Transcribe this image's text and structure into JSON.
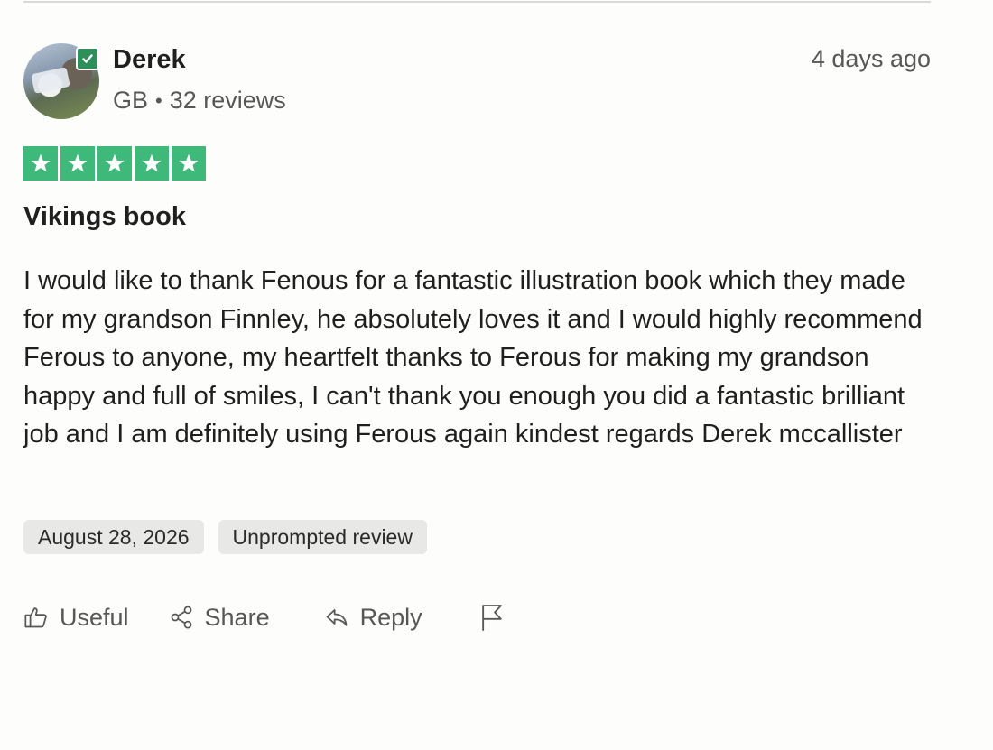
{
  "reviewer": {
    "name": "Derek",
    "country": "GB",
    "separator": "•",
    "reviews_count": "32 reviews",
    "verified": true
  },
  "time_ago": "4 days ago",
  "rating": {
    "stars": 5,
    "max": 5,
    "color": "#3fb97a"
  },
  "review": {
    "title": "Vikings book",
    "body": "I would like to thank Fenous for a fantastic illustration book which they made for my grandson Finnley, he absolutely loves it and I would highly recommend Ferous to anyone, my heartfelt thanks to Ferous for making my grandson happy and full of smiles, I can't thank you enough you did a fantastic brilliant job and I am definitely using Ferous again kindest regards Derek mccallister"
  },
  "chips": {
    "date": "August 28, 2026",
    "type": "Unprompted review"
  },
  "actions": {
    "useful": "Useful",
    "share": "Share",
    "reply": "Reply"
  },
  "icons": {
    "useful": "thumbs-up-icon",
    "share": "share-icon",
    "reply": "reply-icon",
    "report": "flag-icon",
    "verified": "verified-check-icon",
    "star": "star-icon"
  },
  "colors": {
    "star_green": "#3fb97a",
    "verified_green": "#2f8f5b",
    "chip_bg": "#e8e8e6",
    "muted_text": "#575757"
  }
}
